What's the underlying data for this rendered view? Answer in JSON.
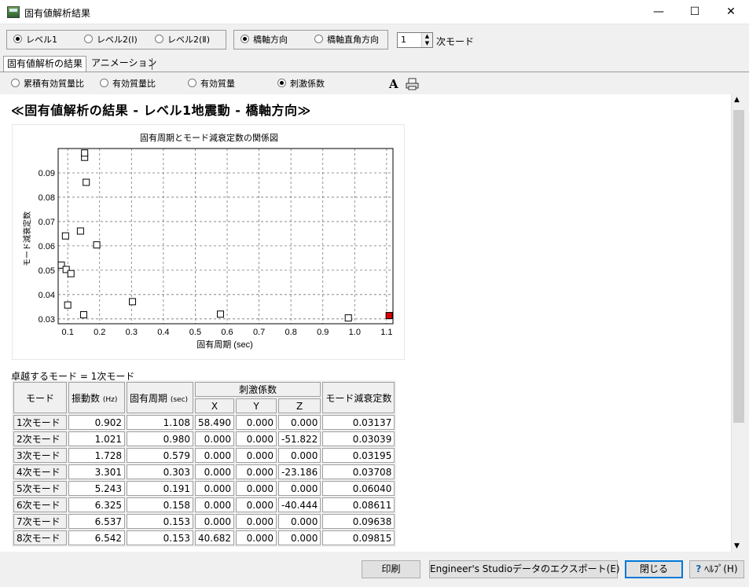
{
  "window": {
    "title": "固有値解析結果",
    "minimize": "—",
    "maximize": "☐",
    "close": "✕"
  },
  "level_group": {
    "options": [
      "レベル1",
      "レベル2(Ⅰ)",
      "レベル2(Ⅱ)"
    ],
    "selected": "レベル1"
  },
  "direction_group": {
    "options": [
      "橋軸方向",
      "橋軸直角方向"
    ],
    "selected": "橋軸方向"
  },
  "mode_spinner": {
    "value": "1",
    "suffix": "次モード"
  },
  "tabs": [
    {
      "label": "固有値解析の結果",
      "active": true
    },
    {
      "label": "アニメーション",
      "active": false
    }
  ],
  "display_options": {
    "options": [
      "累積有効質量比",
      "有効質量比",
      "有効質量",
      "刺激係数"
    ],
    "selected": "刺激係数"
  },
  "toolbar_icons": [
    "font-icon",
    "print-icon"
  ],
  "section_title": "≪固有値解析の結果 - レベル1地震動 - 橋軸方向≫",
  "chart_data": {
    "type": "scatter",
    "title": "固有周期とモード減衰定数の関係図",
    "xlabel": "固有周期 (sec)",
    "ylabel": "モード減衰定数",
    "xlim": [
      0.07,
      1.12
    ],
    "ylim": [
      0.028,
      0.1
    ],
    "xticks": [
      0.1,
      0.2,
      0.3,
      0.4,
      0.5,
      0.6,
      0.7,
      0.8,
      0.9,
      1.0,
      1.1
    ],
    "yticks": [
      0.03,
      0.04,
      0.05,
      0.06,
      0.07,
      0.08,
      0.09
    ],
    "xtick_labels": [
      "0.1",
      "0.2",
      "0.3",
      "0.4",
      "0.5",
      "0.6",
      "0.7",
      "0.8",
      "0.9",
      "1.0",
      "1.1"
    ],
    "ytick_labels": [
      "0.03",
      "0.04",
      "0.05",
      "0.06",
      "0.07",
      "0.08",
      "0.09"
    ],
    "grid": true,
    "highlight_color": "#e00000",
    "points": [
      {
        "x": 1.108,
        "y": 0.03137,
        "highlight": true
      },
      {
        "x": 0.98,
        "y": 0.03039
      },
      {
        "x": 0.579,
        "y": 0.03195
      },
      {
        "x": 0.303,
        "y": 0.03708
      },
      {
        "x": 0.191,
        "y": 0.0604
      },
      {
        "x": 0.158,
        "y": 0.08611
      },
      {
        "x": 0.153,
        "y": 0.09638
      },
      {
        "x": 0.153,
        "y": 0.09815
      },
      {
        "x": 0.14,
        "y": 0.0661
      },
      {
        "x": 0.093,
        "y": 0.0641
      },
      {
        "x": 0.08,
        "y": 0.0521
      },
      {
        "x": 0.095,
        "y": 0.0503
      },
      {
        "x": 0.11,
        "y": 0.0486
      },
      {
        "x": 0.1,
        "y": 0.0357
      },
      {
        "x": 0.15,
        "y": 0.0317
      }
    ]
  },
  "dominant_mode": "卓越するモード = 1次モード",
  "table": {
    "headers": {
      "mode": "モード",
      "freq": "振動数",
      "freq_unit": "(Hz)",
      "period": "固有周期",
      "period_unit": "(sec)",
      "participation": "刺激係数",
      "x": "X",
      "y": "Y",
      "z": "Z",
      "damping": "モード減衰定数"
    },
    "rows": [
      [
        "1次モード",
        "0.902",
        "1.108",
        "58.490",
        "0.000",
        "0.000",
        "0.03137"
      ],
      [
        "2次モード",
        "1.021",
        "0.980",
        "0.000",
        "0.000",
        "-51.822",
        "0.03039"
      ],
      [
        "3次モード",
        "1.728",
        "0.579",
        "0.000",
        "0.000",
        "0.000",
        "0.03195"
      ],
      [
        "4次モード",
        "3.301",
        "0.303",
        "0.000",
        "0.000",
        "-23.186",
        "0.03708"
      ],
      [
        "5次モード",
        "5.243",
        "0.191",
        "0.000",
        "0.000",
        "0.000",
        "0.06040"
      ],
      [
        "6次モード",
        "6.325",
        "0.158",
        "0.000",
        "0.000",
        "-40.444",
        "0.08611"
      ],
      [
        "7次モード",
        "6.537",
        "0.153",
        "0.000",
        "0.000",
        "0.000",
        "0.09638"
      ],
      [
        "8次モード",
        "6.542",
        "0.153",
        "40.682",
        "0.000",
        "0.000",
        "0.09815"
      ]
    ]
  },
  "bottom_buttons": {
    "print": "印刷",
    "export": "Engineer's Studioデータのエクスポート(E)",
    "close": "閉じる",
    "help": "ﾍﾙﾌﾟ(H)"
  }
}
